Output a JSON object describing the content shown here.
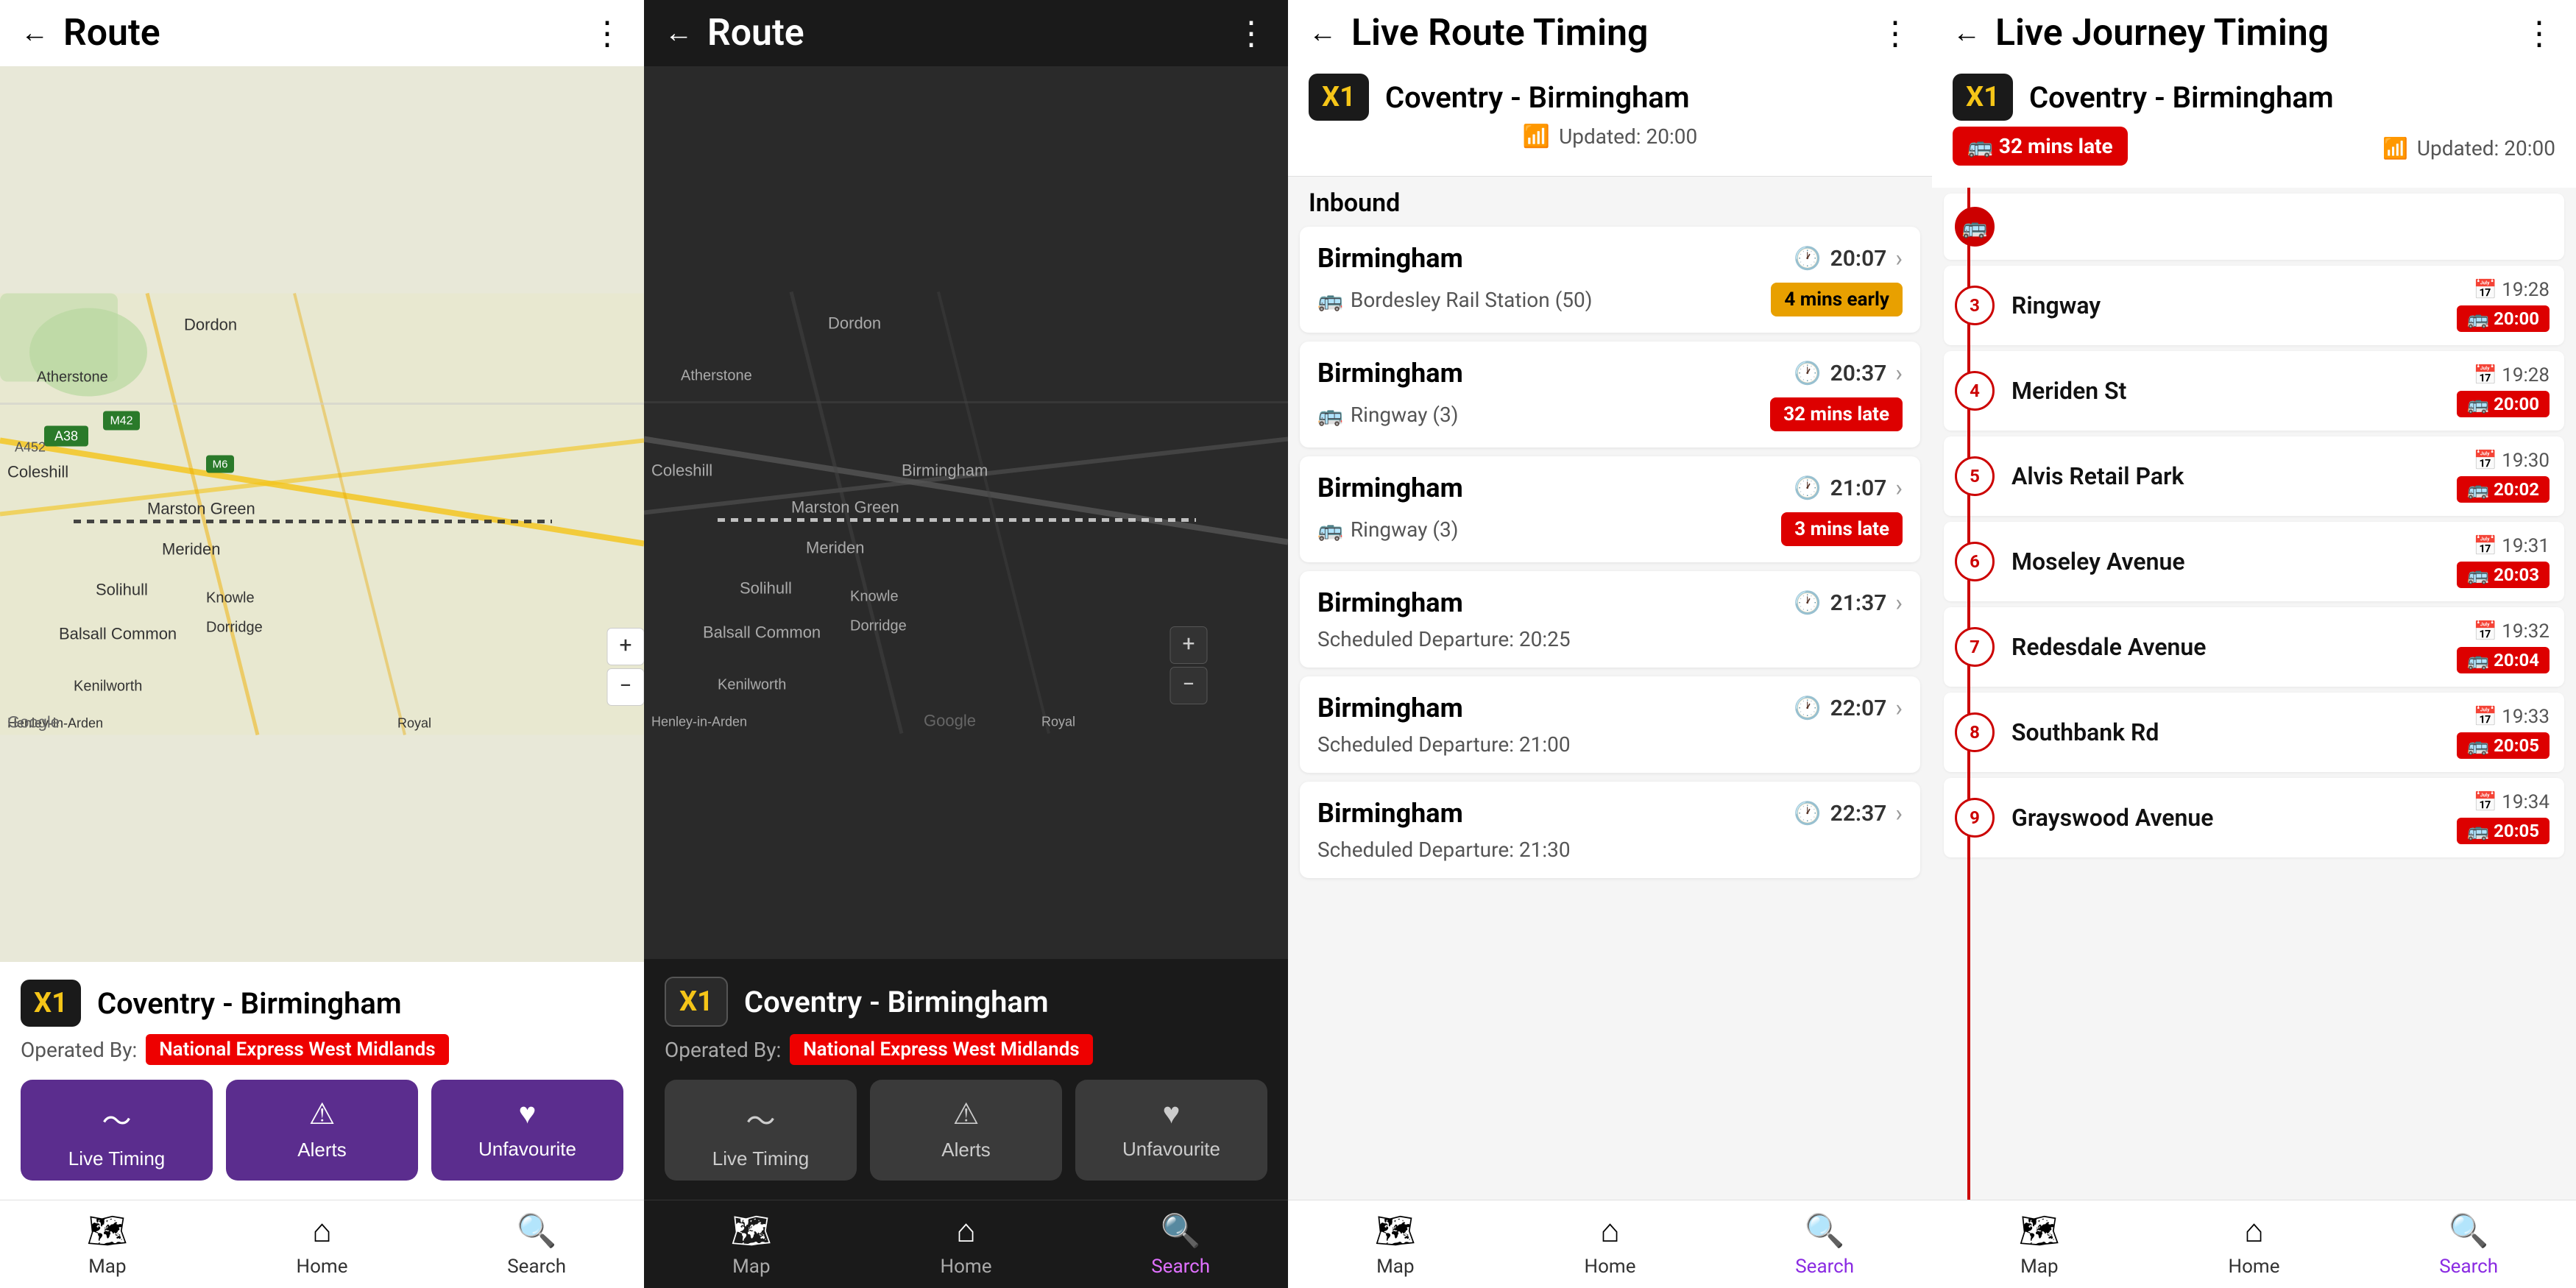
{
  "panels": [
    {
      "id": "panel1",
      "theme": "light",
      "topbar": {
        "back_label": "←",
        "title": "Route",
        "more_label": "⋮"
      },
      "route_badge": "X1",
      "route_name": "Coventry - Birmingham",
      "operator_prefix": "Operated By:",
      "operator_name": "National Express West Midlands",
      "action_buttons": [
        {
          "label": "Live Timing",
          "icon": "📊"
        },
        {
          "label": "Alerts",
          "icon": "⚠"
        },
        {
          "label": "Unfavourite",
          "icon": "♥"
        }
      ],
      "nav_items": [
        {
          "label": "Map",
          "icon": "🗺",
          "active": false
        },
        {
          "label": "Home",
          "icon": "🏠",
          "active": false
        },
        {
          "label": "Search",
          "icon": "🔍",
          "active": false
        }
      ]
    },
    {
      "id": "panel2",
      "theme": "dark",
      "topbar": {
        "back_label": "←",
        "title": "Route",
        "more_label": "⋮"
      },
      "route_badge": "X1",
      "route_name": "Coventry - Birmingham",
      "operator_prefix": "Operated By:",
      "operator_name": "National Express West Midlands",
      "action_buttons": [
        {
          "label": "Live Timing",
          "icon": "📊"
        },
        {
          "label": "Alerts",
          "icon": "⚠"
        },
        {
          "label": "Unfavourite",
          "icon": "♥"
        }
      ],
      "nav_items": [
        {
          "label": "Map",
          "icon": "🗺",
          "active": false
        },
        {
          "label": "Home",
          "icon": "🏠",
          "active": false
        },
        {
          "label": "Search",
          "icon": "🔍",
          "active": true
        }
      ]
    },
    {
      "id": "panel3",
      "theme": "light",
      "topbar": {
        "back_label": "←",
        "title": "Live Route Timing",
        "more_label": "⋮"
      },
      "route_badge": "X1",
      "route_name": "Coventry - Birmingham",
      "updated_label": "Updated: 20:00",
      "direction_label": "Inbound",
      "departures": [
        {
          "destination": "Birmingham",
          "time": "20:07",
          "stop": "Bordesley Rail Station (50)",
          "status": "4 mins early",
          "status_type": "yellow"
        },
        {
          "destination": "Birmingham",
          "time": "20:37",
          "stop": "Ringway (3)",
          "status": "32 mins late",
          "status_type": "red"
        },
        {
          "destination": "Birmingham",
          "time": "21:07",
          "stop": "Ringway (3)",
          "status": "3 mins late",
          "status_type": "red"
        },
        {
          "destination": "Birmingham",
          "time": "21:37",
          "stop": "",
          "scheduled": "Scheduled Departure: 20:25",
          "status": "",
          "status_type": "none"
        },
        {
          "destination": "Birmingham",
          "time": "22:07",
          "stop": "",
          "scheduled": "Scheduled Departure: 21:00",
          "status": "",
          "status_type": "none"
        },
        {
          "destination": "Birmingham",
          "time": "22:37",
          "stop": "",
          "scheduled": "Scheduled Departure: 21:30",
          "status": "",
          "status_type": "none"
        }
      ],
      "nav_items": [
        {
          "label": "Map",
          "icon": "🗺",
          "active": false
        },
        {
          "label": "Home",
          "icon": "🏠",
          "active": false
        },
        {
          "label": "Search",
          "icon": "🔍",
          "active": true
        }
      ]
    },
    {
      "id": "panel4",
      "theme": "light",
      "topbar": {
        "back_label": "←",
        "title": "Live Journey Timing",
        "more_label": "⋮"
      },
      "route_badge": "X1",
      "route_name": "Coventry - Birmingham",
      "late_badge": "🚌 32 mins late",
      "updated_label": "Updated: 20:00",
      "stops": [
        {
          "num": "bus",
          "name": "",
          "sched": "",
          "live": ""
        },
        {
          "num": "3",
          "name": "Ringway",
          "sched": "19:28",
          "live": "20:00"
        },
        {
          "num": "4",
          "name": "Meriden St",
          "sched": "19:28",
          "live": "20:00"
        },
        {
          "num": "5",
          "name": "Alvis Retail Park",
          "sched": "19:30",
          "live": "20:02"
        },
        {
          "num": "6",
          "name": "Moseley Avenue",
          "sched": "19:31",
          "live": "20:03"
        },
        {
          "num": "7",
          "name": "Redesdale Avenue",
          "sched": "19:32",
          "live": "20:04"
        },
        {
          "num": "8",
          "name": "Southbank Rd",
          "sched": "19:33",
          "live": "20:05"
        },
        {
          "num": "9",
          "name": "Grayswood Avenue",
          "sched": "19:34",
          "live": "20:05"
        }
      ],
      "nav_items": [
        {
          "label": "Map",
          "icon": "🗺",
          "active": false
        },
        {
          "label": "Home",
          "icon": "🏠",
          "active": false
        },
        {
          "label": "Search",
          "icon": "🔍",
          "active": true
        }
      ]
    }
  ]
}
